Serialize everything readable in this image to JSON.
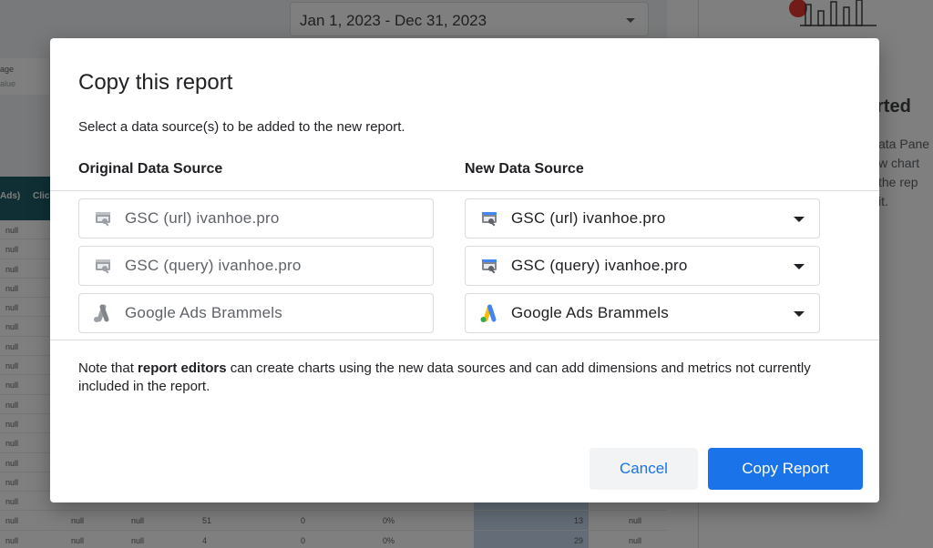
{
  "background": {
    "date_range": "Jan 1, 2023 - Dec 31, 2023",
    "filter_line1": "age",
    "filter_line2": "alue",
    "table_headers": [
      "Ads)",
      "Clic"
    ],
    "null_text": "null",
    "bottom_rows": [
      {
        "c1": "null",
        "c2": "null",
        "c3": "null",
        "c4": "51",
        "c5": "0",
        "c6": "0%",
        "c7": "13",
        "c8": "null"
      },
      {
        "c1": "null",
        "c2": "null",
        "c3": "null",
        "c4": "4",
        "c5": "0",
        "c6": "0%",
        "c7": "29",
        "c8": "null"
      }
    ],
    "panel_title": "rted",
    "panel_text": [
      "ata Pane",
      "w chart",
      "the rep",
      "it."
    ]
  },
  "dialog": {
    "title": "Copy this report",
    "subtitle": "Select a data source(s) to be added to the new report.",
    "original_header": "Original Data Source",
    "new_header": "New Data Source",
    "rows": [
      {
        "original": "GSC (url) ivanhoe.pro",
        "new": "GSC (url) ivanhoe.pro",
        "icon": "search-console-icon"
      },
      {
        "original": "GSC (query) ivanhoe.pro",
        "new": "GSC (query) ivanhoe.pro",
        "icon": "search-console-icon"
      },
      {
        "original": "Google Ads Brammels",
        "new": "Google Ads Brammels",
        "icon": "google-ads-icon"
      }
    ],
    "note_prefix": "Note that ",
    "note_bold": "report editors",
    "note_suffix": " can create charts using the new data sources and can add dimensions and metrics not currently included in the report.",
    "cancel_label": "Cancel",
    "copy_label": "Copy Report"
  },
  "colors": {
    "accent": "#1a73e8",
    "ads_yellow": "#fbbc04",
    "ads_blue": "#4285f4",
    "ads_green": "#34a853"
  }
}
